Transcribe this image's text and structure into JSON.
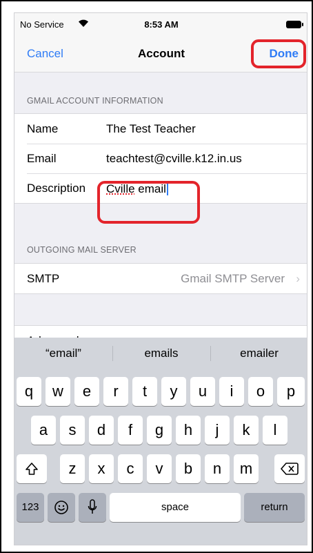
{
  "status_bar": {
    "carrier": "No Service",
    "time": "8:53 AM",
    "wifi_icon": "wifi-icon",
    "battery_icon": "battery-icon"
  },
  "nav": {
    "cancel_label": "Cancel",
    "title": "Account",
    "done_label": "Done"
  },
  "gmail_section": {
    "header": "GMAIL ACCOUNT INFORMATION",
    "rows": [
      {
        "label": "Name",
        "value": "The Test Teacher"
      },
      {
        "label": "Email",
        "value": "teachtest@cville.k12.in.us"
      },
      {
        "label": "Description",
        "value_misspelled": "Cville",
        "value_rest": " email"
      }
    ]
  },
  "outgoing_section": {
    "header": "OUTGOING MAIL SERVER",
    "rows": [
      {
        "label": "SMTP",
        "value": "Gmail SMTP Server"
      }
    ]
  },
  "advanced_row": {
    "label": "Advanced"
  },
  "keyboard": {
    "predictions": [
      "“email”",
      "emails",
      "emailer"
    ],
    "row1": [
      "q",
      "w",
      "e",
      "r",
      "t",
      "y",
      "u",
      "i",
      "o",
      "p"
    ],
    "row2": [
      "a",
      "s",
      "d",
      "f",
      "g",
      "h",
      "j",
      "k",
      "l"
    ],
    "row3": [
      "z",
      "x",
      "c",
      "v",
      "b",
      "n",
      "m"
    ],
    "numbers_label": "123",
    "space_label": "space",
    "return_label": "return",
    "shift_icon": "shift-icon",
    "delete_icon": "delete-icon",
    "emoji_icon": "emoji-icon",
    "mic_icon": "microphone-icon"
  },
  "highlight_color": "#e3242b",
  "accent_color": "#2f7cf6"
}
